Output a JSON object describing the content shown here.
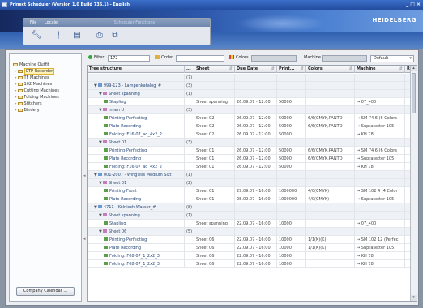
{
  "window": {
    "title": "Prinect Scheduler (Version 1.0 Build 736.1) - English",
    "controls": "_ □ ×"
  },
  "brand": {
    "logo": "HEIDELBERG"
  },
  "menu": {
    "items": [
      "File",
      "Locale"
    ],
    "ghost": "Scheduler Functions"
  },
  "toolbar": {
    "icons": [
      "wrench-icon",
      "pin-icon",
      "document-icon",
      "printer-icon",
      "copy-icon"
    ]
  },
  "sidebar": {
    "root": "Machine Outfit",
    "items": [
      {
        "label": "CTP-Recorder",
        "selected": true
      },
      {
        "label": "TF Machines",
        "selected": false
      },
      {
        "label": "102 Machines",
        "selected": false
      },
      {
        "label": "Cutting Machines",
        "selected": false
      },
      {
        "label": "Folding Machines",
        "selected": false
      },
      {
        "label": "Stitchers",
        "selected": false
      },
      {
        "label": "Bindery",
        "selected": false
      }
    ],
    "calendar_button": "Company Calendar ..."
  },
  "filter": {
    "label": "Filter",
    "value": "172",
    "order_label": "Order",
    "order_value": "",
    "colors_label": "Colors",
    "colors_value": "",
    "machine_label": "Machine",
    "machine_value": "",
    "view_select": "Default"
  },
  "grid": {
    "columns": [
      "Tree structure",
      "...",
      "Sheet",
      "Due Date",
      "Print...",
      "Colors",
      "Machine",
      "R"
    ],
    "rows": [
      {
        "type": "group",
        "indent": 0,
        "tg": "",
        "icon": "",
        "tree": "",
        "count": "(7)",
        "sheet": "",
        "due": "",
        "print": "",
        "colors": "",
        "machine": ""
      },
      {
        "type": "job",
        "indent": 1,
        "tg": "▼",
        "icon": "job",
        "tree": "999-123 - Lampenkatalog_#",
        "count": "(3)",
        "sheet": "",
        "due": "",
        "print": "",
        "colors": "",
        "machine": ""
      },
      {
        "type": "part",
        "indent": 2,
        "tg": "▼",
        "icon": "part",
        "tree": "Sheet spanning",
        "count": "(1)",
        "sheet": "",
        "due": "",
        "print": "",
        "colors": "",
        "machine": ""
      },
      {
        "type": "step",
        "indent": 3,
        "tg": "",
        "icon": "step",
        "tree": "Stapling",
        "count": "",
        "sheet": "Sheet spanning",
        "due": "26.09.07 - 12:00",
        "print": "50000",
        "colors": "",
        "machine": "→ 07_400"
      },
      {
        "type": "part",
        "indent": 2,
        "tg": "▼",
        "icon": "part",
        "tree": "Innen U",
        "count": "(3)",
        "sheet": "",
        "due": "",
        "print": "",
        "colors": "",
        "machine": ""
      },
      {
        "type": "step",
        "indent": 3,
        "tg": "",
        "icon": "step",
        "tree": "Printing-Perfecting",
        "count": "",
        "sheet": "Sheet 02",
        "due": "26.09.07 - 12:00",
        "print": "50000",
        "colors": "6/6(CMYK,PANTO",
        "machine": "→ SM 74 6 (6 Colors"
      },
      {
        "type": "step",
        "indent": 3,
        "tg": "",
        "icon": "step",
        "tree": "Plate Recording",
        "count": "",
        "sheet": "Sheet 02",
        "due": "26.09.07 - 12:00",
        "print": "50000",
        "colors": "6/6(CMYK,PANTO",
        "machine": "→ Suprasetter 105"
      },
      {
        "type": "step",
        "indent": 3,
        "tg": "",
        "icon": "step",
        "tree": "Folding: F16-07_ad_4x2_2",
        "count": "",
        "sheet": "Sheet 02",
        "due": "26.09.07 - 12:00",
        "print": "50000",
        "colors": "",
        "machine": "→ KH 78"
      },
      {
        "type": "part",
        "indent": 2,
        "tg": "▼",
        "icon": "part",
        "tree": "Sheet 01",
        "count": "(3)",
        "sheet": "",
        "due": "",
        "print": "",
        "colors": "",
        "machine": ""
      },
      {
        "type": "step",
        "indent": 3,
        "tg": "",
        "icon": "step",
        "tree": "Printing-Perfecting",
        "count": "",
        "sheet": "Sheet 01",
        "due": "26.09.07 - 12:00",
        "print": "50000",
        "colors": "6/6(CMYK,PANTO",
        "machine": "→ SM 74 6 (6 Colors"
      },
      {
        "type": "step",
        "indent": 3,
        "tg": "",
        "icon": "step",
        "tree": "Plate Recording",
        "count": "",
        "sheet": "Sheet 01",
        "due": "26.09.07 - 12:00",
        "print": "50000",
        "colors": "6/6(CMYK,PANTO",
        "machine": "→ Suprasetter 105"
      },
      {
        "type": "step",
        "indent": 3,
        "tg": "",
        "icon": "step",
        "tree": "Folding: F16-07_ad_4x2_2",
        "count": "",
        "sheet": "Sheet 01",
        "due": "26.09.07 - 12:00",
        "print": "50000",
        "colors": "",
        "machine": "→ KH 78"
      },
      {
        "type": "job",
        "indent": 1,
        "tg": "▼",
        "icon": "job",
        "tree": "001-2007 - Wingless Medium Sizt",
        "count": "(1)",
        "sheet": "",
        "due": "",
        "print": "",
        "colors": "",
        "machine": ""
      },
      {
        "type": "part",
        "indent": 2,
        "tg": "▼",
        "icon": "part",
        "tree": "Sheet 01",
        "count": "(2)",
        "sheet": "",
        "due": "",
        "print": "",
        "colors": "",
        "machine": ""
      },
      {
        "type": "step",
        "indent": 3,
        "tg": "",
        "icon": "step",
        "tree": "Printing-Front",
        "count": "",
        "sheet": "Sheet 01",
        "due": "29.09.07 - 16:00",
        "print": "1000000",
        "colors": "4/0(CMYK)",
        "machine": "→ SM 102 4 (4 Color"
      },
      {
        "type": "step",
        "indent": 3,
        "tg": "",
        "icon": "step",
        "tree": "Plate Recording",
        "count": "",
        "sheet": "Sheet 01",
        "due": "28.09.07 - 16:00",
        "print": "1000000",
        "colors": "4/0(CMYK)",
        "machine": "→ Suprasetter 105"
      },
      {
        "type": "job",
        "indent": 1,
        "tg": "▼",
        "icon": "job",
        "tree": "4711 - Kölnisch Wasser_#",
        "count": "(8)",
        "sheet": "",
        "due": "",
        "print": "",
        "colors": "",
        "machine": ""
      },
      {
        "type": "part",
        "indent": 2,
        "tg": "▼",
        "icon": "part",
        "tree": "Sheet spanning",
        "count": "(1)",
        "sheet": "",
        "due": "",
        "print": "",
        "colors": "",
        "machine": ""
      },
      {
        "type": "step",
        "indent": 3,
        "tg": "",
        "icon": "step",
        "tree": "Stapling",
        "count": "",
        "sheet": "Sheet spanning",
        "due": "22.09.07 - 16:00",
        "print": "10000",
        "colors": "",
        "machine": "→ 07_400"
      },
      {
        "type": "part",
        "indent": 2,
        "tg": "▼",
        "icon": "part",
        "tree": "Sheet 06",
        "count": "(5)",
        "sheet": "",
        "due": "",
        "print": "",
        "colors": "",
        "machine": ""
      },
      {
        "type": "step",
        "indent": 3,
        "tg": "",
        "icon": "step",
        "tree": "Printing-Perfecting",
        "count": "",
        "sheet": "Sheet 06",
        "due": "22.09.07 - 16:00",
        "print": "10000",
        "colors": "1/1(K)(K)",
        "machine": "→ SM 102 12 (Perfec"
      },
      {
        "type": "step",
        "indent": 3,
        "tg": "",
        "icon": "step",
        "tree": "Plate Recording",
        "count": "",
        "sheet": "Sheet 06",
        "due": "22.09.07 - 16:00",
        "print": "10000",
        "colors": "1/1(K)(K)",
        "machine": "→ Suprasetter 105"
      },
      {
        "type": "step",
        "indent": 3,
        "tg": "",
        "icon": "step",
        "tree": "Folding: F08-07_1_2x2_3",
        "count": "",
        "sheet": "Sheet 06",
        "due": "22.09.07 - 16:00",
        "print": "10000",
        "colors": "",
        "machine": "→ KH 78"
      },
      {
        "type": "step",
        "indent": 3,
        "tg": "",
        "icon": "step",
        "tree": "Folding: F08-07_1_2x2_3",
        "count": "",
        "sheet": "Sheet 06",
        "due": "22.09.07 - 16:00",
        "print": "10000",
        "colors": "",
        "machine": "→ KH 78"
      }
    ]
  }
}
